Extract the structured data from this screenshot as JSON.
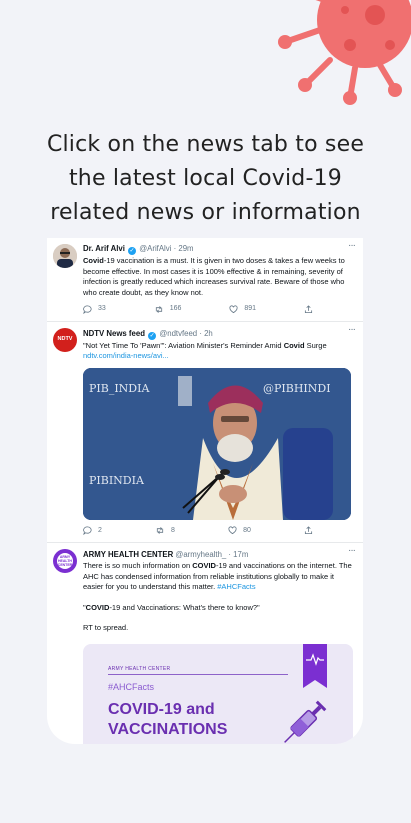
{
  "headline": {
    "line1": "Click on the news tab to see",
    "line2": "the latest local Covid-19",
    "line3": "related news or information"
  },
  "tweets": [
    {
      "name": "Dr. Arif Alvi",
      "handle": "@ArifAlvi",
      "time": "· 29m",
      "text_bold": "Covid",
      "text_rest": "-19 vaccination is a must. It is given in two doses & takes a few weeks to become effective. In most cases it is 100% effective & in remaining, severity of infection is greatly reduced which increases survival rate. Beware of those who who create doubt, as they know not.",
      "replies": "33",
      "retweets": "166",
      "likes": "891"
    },
    {
      "name": "NDTV News feed",
      "handle": "@ndtvfeed",
      "time": "· 2h",
      "text_pre": "\"Not Yet Time To 'Pawn'\": Aviation Minister's Reminder Amid ",
      "text_bold": "Covid",
      "text_post": " Surge",
      "link": "ndtv.com/india-news/avi...",
      "replies": "2",
      "retweets": "8",
      "likes": "80",
      "avatar_text": "NDTV",
      "image_text_left": "PIB_INDIA",
      "image_text_right": "@PIBHINDI",
      "image_text_bottom": "PIBINDIA"
    },
    {
      "name": "ARMY HEALTH CENTER",
      "handle": "@armyhealth_",
      "time": "· 17m",
      "text_pre": "There is so much information on ",
      "text_bold": "COVID",
      "text_post": "-19 and vaccinations on the internet. The AHC has condensed information from reliable institutions globally to make it easier for you to understand this matter. ",
      "hashtag": "#AHCFacts",
      "quote_bold": "COVID",
      "quote_rest": "-19 and Vaccinations: What's there to know?\"",
      "quote_open": "\"",
      "rt_line": "RT to spread.",
      "card_small": "ARMY HEALTH CENTER",
      "card_tag": "#AHCFacts",
      "card_title1": "COVID-19 and",
      "card_title2": "VACCINATIONS",
      "avatar_text": "ARMY HEALTH CENTER"
    }
  ],
  "more_label": "···",
  "colors": {
    "accent": "#1da1f2",
    "virus": "#f06a6a",
    "purple": "#6a2fb0"
  }
}
